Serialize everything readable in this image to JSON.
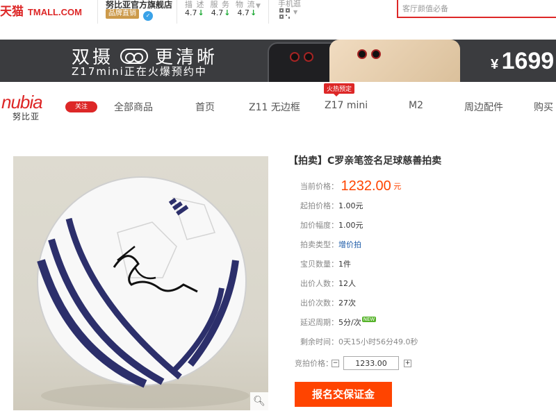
{
  "header": {
    "logo_cn": "天猫",
    "logo_en": "TMALL.COM",
    "store_name": "努比亚官方旗舰店",
    "store_badge": "品牌直销",
    "ratings_labels": [
      "描 述",
      "服 务",
      "物 流"
    ],
    "ratings": [
      "4.7",
      "4.7",
      "4.7"
    ],
    "mobile_label": "手机逛",
    "search_placeholder": "客厅颜值必备"
  },
  "banner": {
    "headline_left": "双摄",
    "headline_right": "更清晰",
    "subtitle": "Z17mini正在火爆预约中",
    "price_currency": "¥",
    "price": "1699"
  },
  "nav": {
    "brand": "nubia",
    "brand_cn": "努比亚",
    "follow_label": "关注",
    "items": [
      "全部商品",
      "首页",
      "Z11 无边框",
      "Z17 mini",
      "M2",
      "周边配件",
      "购买"
    ],
    "hot_badge": "火热预定"
  },
  "product": {
    "title": "【拍卖】C罗亲笔签名足球慈善拍卖",
    "current_price_label": "当前价格：",
    "current_price": "1232.00",
    "current_price_unit": "元",
    "rows": [
      {
        "label": "起拍价格：",
        "value": "1.00元"
      },
      {
        "label": "加价幅度：",
        "value": "1.00元"
      },
      {
        "label": "拍卖类型：",
        "value": "增价拍"
      },
      {
        "label": "宝贝数量：",
        "value": "1件"
      },
      {
        "label": "出价人数：",
        "value": "12人"
      },
      {
        "label": "出价次数：",
        "value": "27次"
      },
      {
        "label": "延迟周期：",
        "value": "5分/次"
      },
      {
        "label": "剩余时间：",
        "value": "0天15小时56分49.0秒"
      }
    ],
    "new_badge": "NEW",
    "bid_label": "竞拍价格：",
    "bid_minus": "−",
    "bid_plus": "+",
    "bid_value": "1233.00",
    "deposit_button": "报名交保证金"
  },
  "colors": {
    "brand_red": "#dd2727",
    "price_orange": "#ff4400",
    "banner_bg": "#3b3c3f"
  }
}
